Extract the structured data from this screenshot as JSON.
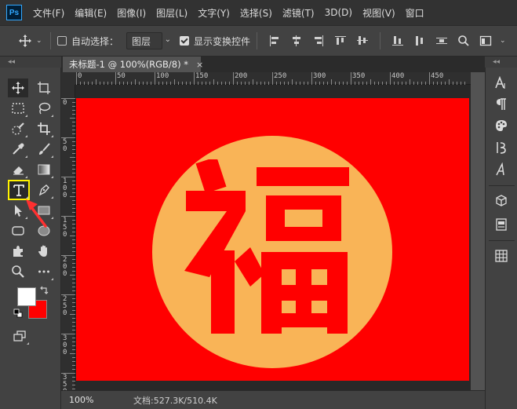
{
  "app": {
    "logo": "Ps"
  },
  "menu": [
    "文件(F)",
    "编辑(E)",
    "图像(I)",
    "图层(L)",
    "文字(Y)",
    "选择(S)",
    "滤镜(T)",
    "3D(D)",
    "视图(V)",
    "窗口"
  ],
  "options": {
    "auto_select_label": "自动选择：",
    "auto_select_checked": false,
    "auto_select_target": "图层",
    "show_transform_label": "显示变换控件",
    "show_transform_checked": true
  },
  "document": {
    "tab_title": "未标题-1 @ 100%(RGB/8) *",
    "close_glyph": "×",
    "zoom": "100%",
    "info": "文档:527.3K/510.4K",
    "canvas_text": "福",
    "colors": {
      "canvas": "#ff0000",
      "circle": "#f9b457",
      "glyph": "#ff0000"
    }
  },
  "ruler": {
    "top_labels": [
      "0",
      "50",
      "100",
      "150",
      "200",
      "250",
      "300",
      "350",
      "400",
      "450"
    ],
    "left_labels": [
      "0",
      "5\n0",
      "1\n0\n0",
      "1\n5\n0",
      "2\n0\n0",
      "2\n5\n0",
      "3\n0\n0",
      "3\n5\n0"
    ]
  },
  "swatches": {
    "foreground": "#ffffff",
    "background": "#ff0000"
  },
  "panel_collapse_glyph": "◂◂"
}
